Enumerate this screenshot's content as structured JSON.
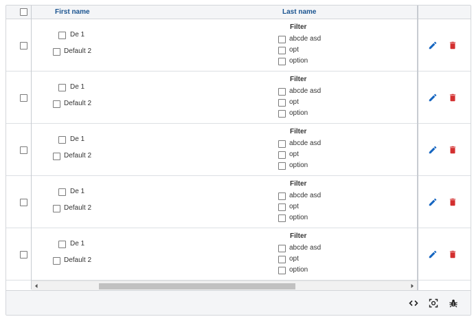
{
  "columns": {
    "first_name": "First name",
    "last_name": "Last name"
  },
  "rows": [
    {
      "first_options": [
        "De 1",
        "Default 2"
      ],
      "filter_title": "Filter",
      "filter_options": [
        "abcde asd",
        "opt",
        "option"
      ]
    },
    {
      "first_options": [
        "De 1",
        "Default 2"
      ],
      "filter_title": "Filter",
      "filter_options": [
        "abcde asd",
        "opt",
        "option"
      ]
    },
    {
      "first_options": [
        "De 1",
        "Default 2"
      ],
      "filter_title": "Filter",
      "filter_options": [
        "abcde asd",
        "opt",
        "option"
      ]
    },
    {
      "first_options": [
        "De 1",
        "Default 2"
      ],
      "filter_title": "Filter",
      "filter_options": [
        "abcde asd",
        "opt",
        "option"
      ]
    },
    {
      "first_options": [
        "De 1",
        "Default 2"
      ],
      "filter_title": "Filter",
      "filter_options": [
        "abcde asd",
        "opt",
        "option"
      ]
    }
  ],
  "icons": {
    "edit": "pencil-icon",
    "delete": "trash-icon",
    "code": "code-icon",
    "screenshot": "screenshot-icon",
    "debug": "bug-icon"
  },
  "colors": {
    "header_text": "#1a5490",
    "edit_icon": "#1565c0",
    "delete_icon": "#d32f2f"
  }
}
